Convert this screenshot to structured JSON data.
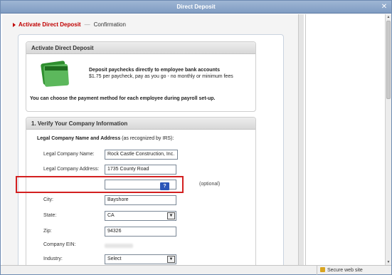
{
  "window": {
    "title": "Direct Deposit",
    "close_glyph": "✕"
  },
  "steps": {
    "active": "Activate Direct Deposit",
    "separator": "—",
    "next": "Confirmation"
  },
  "activate_card": {
    "title": "Activate Direct Deposit",
    "logo_text": [
      "intuit",
      "QuickBooks",
      "Direct Deposit"
    ],
    "headline": "Deposit paychecks directly to employee bank accounts",
    "pricing": "$1.75 per paycheck, pay as you go - no monthly or minimum fees",
    "note": "You can choose the payment method for each employee during payroll set-up."
  },
  "verify_card": {
    "title": "1. Verify Your Company Information",
    "legal_heading": "Legal Company Name and Address",
    "legal_sub": "(as recognized by IRS):",
    "fields": {
      "name": {
        "label": "Legal Company Name:",
        "value": "Rock Castle Construction, Inc."
      },
      "address": {
        "label": "Legal Company Address:",
        "value": "1735 County Road"
      },
      "address2": {
        "value": "",
        "note": "(optional)"
      },
      "city": {
        "label": "City:",
        "value": "Bayshore"
      },
      "state": {
        "label": "State:",
        "value": "CA"
      },
      "zip": {
        "label": "Zip:",
        "value": "94326"
      },
      "ein": {
        "label": "Company EIN:"
      },
      "industry": {
        "label": "Industry:",
        "value": "Select",
        "help": "?"
      }
    }
  },
  "status": {
    "secure": "Secure web site"
  },
  "icons": {
    "close": "close-icon",
    "lock": "lock-icon",
    "dropdown": "chevron-down-icon",
    "help": "help-icon"
  },
  "colors": {
    "accent_red": "#c00000",
    "help_blue": "#2b55b8",
    "highlight": "#d32020"
  }
}
